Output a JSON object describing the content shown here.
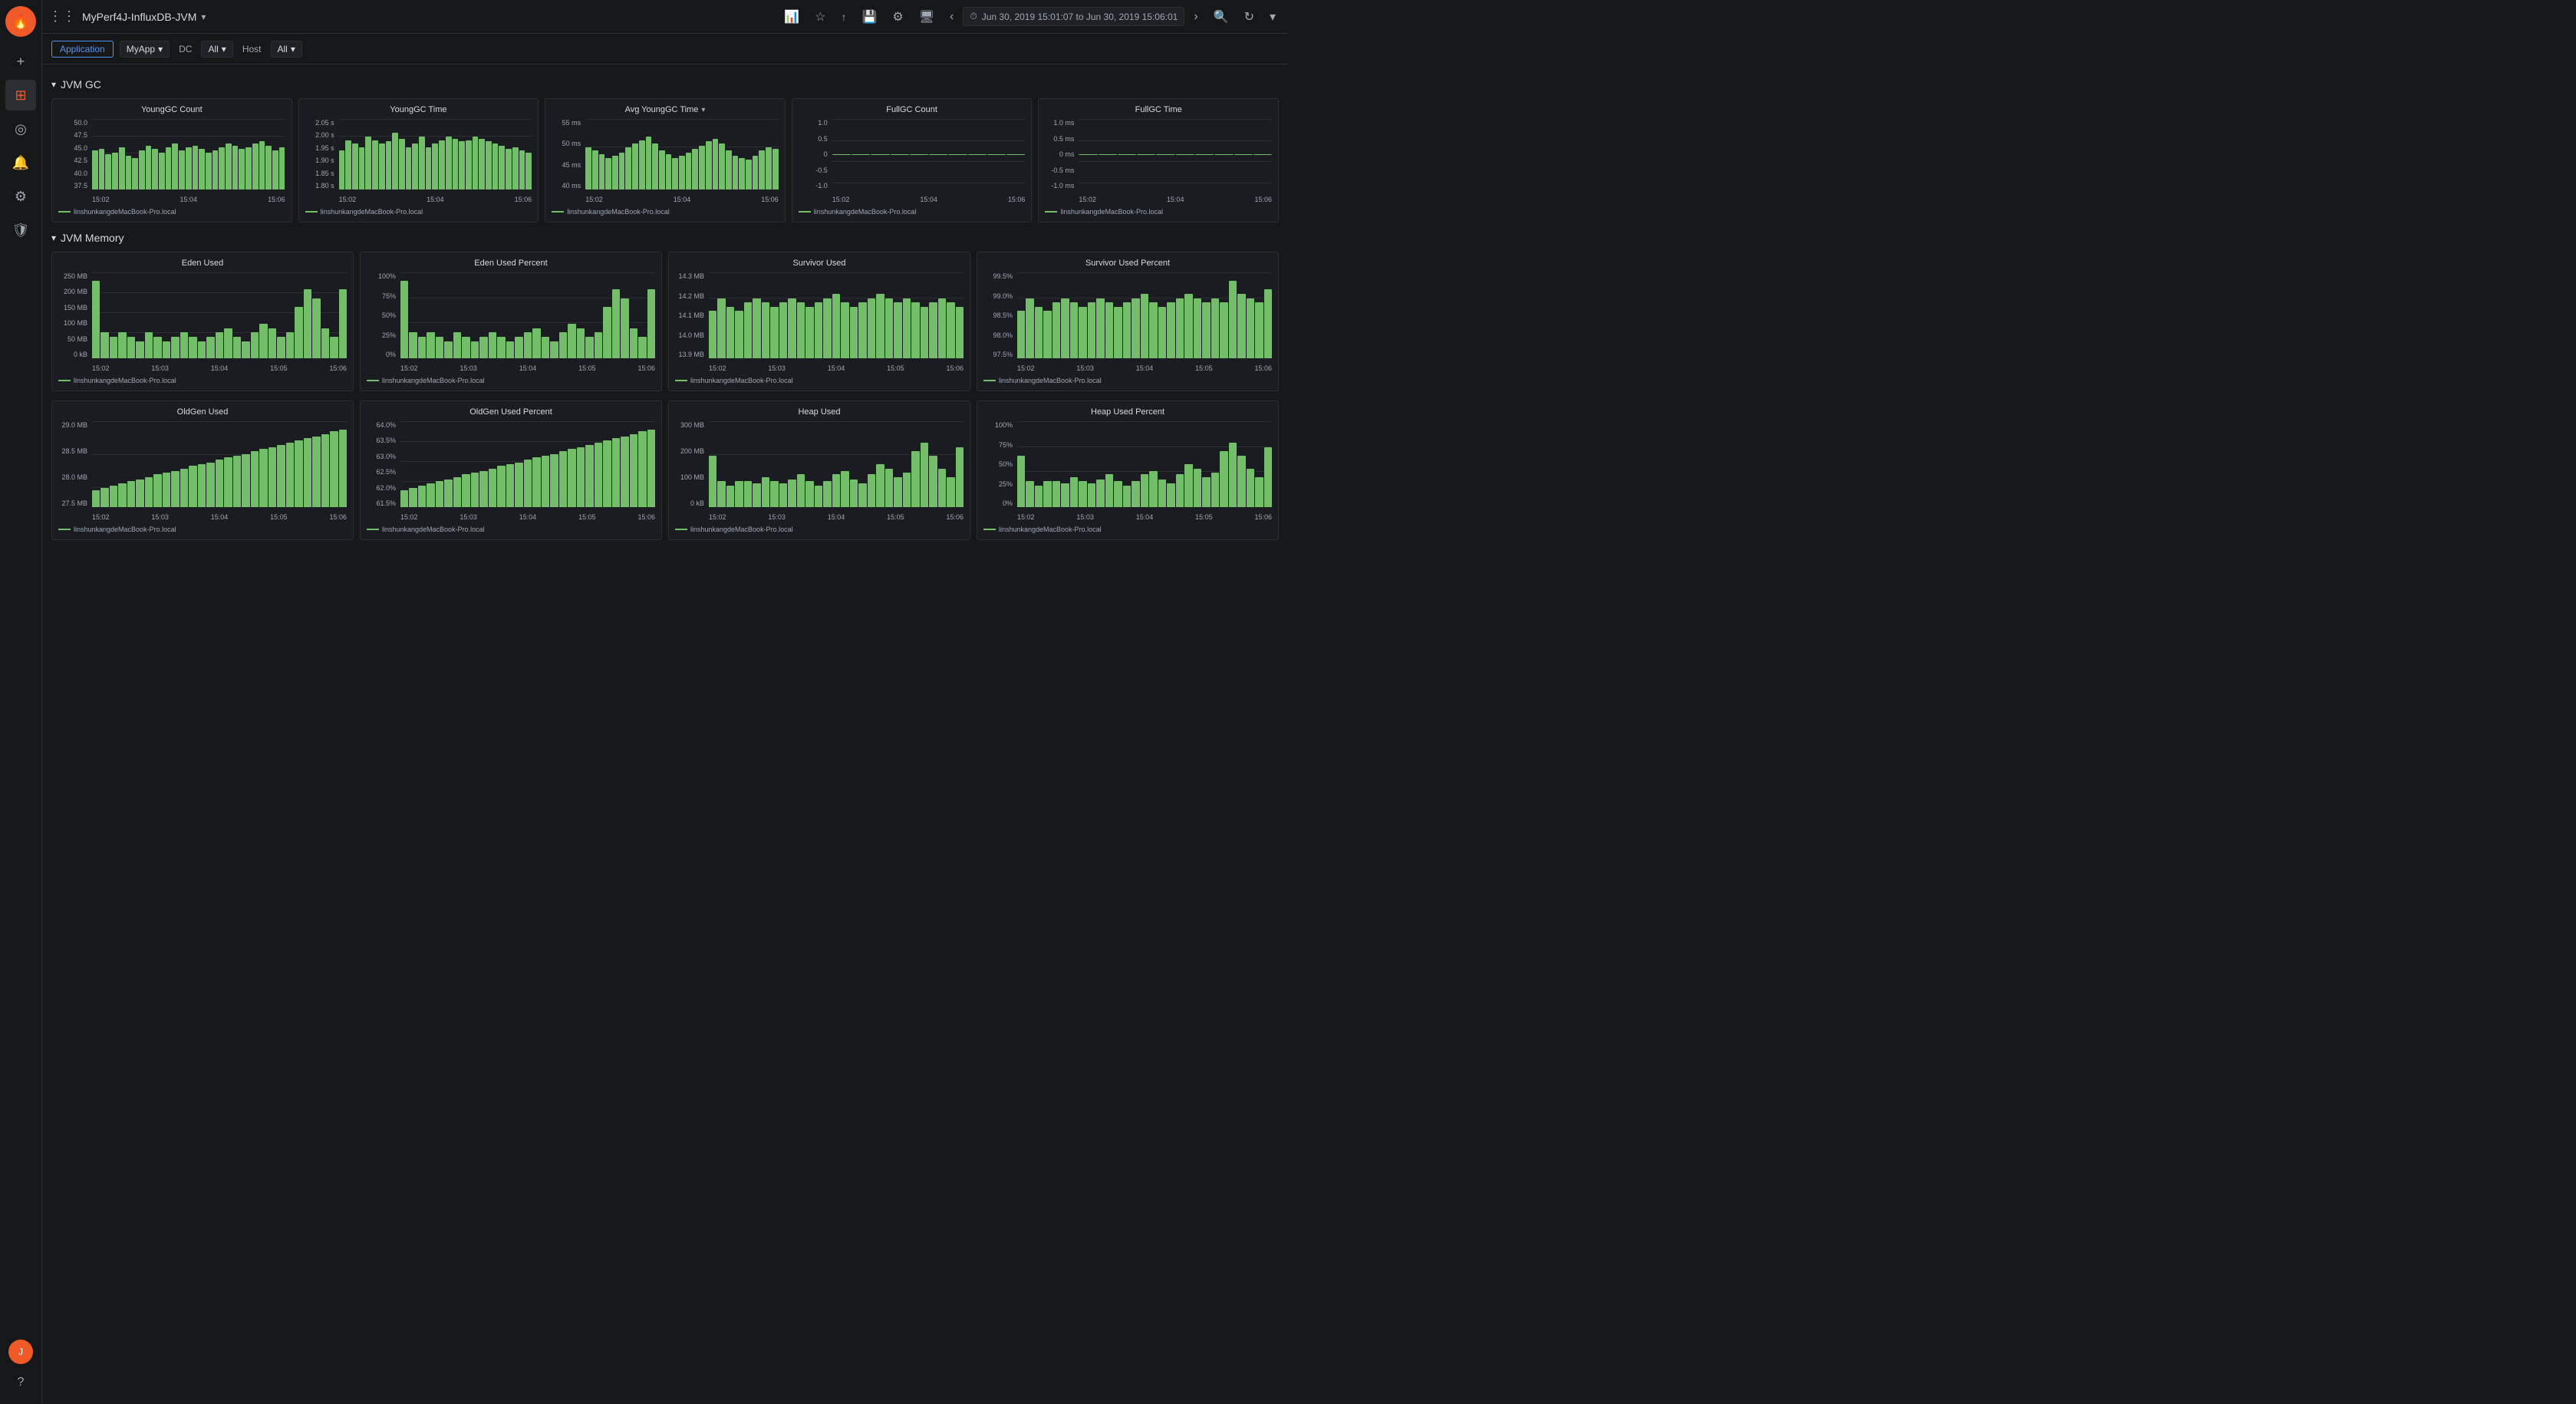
{
  "app": {
    "title": "MyPerf4J-InfluxDB-JVM",
    "logo_symbol": "🔥"
  },
  "topbar": {
    "time_range": "Jun 30, 2019 15:01:07 to Jun 30, 2019 15:06:01"
  },
  "sidebar": {
    "items": [
      {
        "label": "Add",
        "icon": "+"
      },
      {
        "label": "Dashboard",
        "icon": "⊞"
      },
      {
        "label": "Explore",
        "icon": "◎"
      },
      {
        "label": "Alerting",
        "icon": "🔔"
      },
      {
        "label": "Settings",
        "icon": "⚙"
      },
      {
        "label": "Shield",
        "icon": "🛡"
      }
    ]
  },
  "nav": {
    "application_label": "Application",
    "myapp_label": "MyApp",
    "dc_label": "DC",
    "dc_value": "All",
    "host_label": "Host",
    "host_value": "All"
  },
  "sections": [
    {
      "title": "JVM GC",
      "charts": [
        {
          "title": "YoungGC Count",
          "y_labels": [
            "50.0",
            "47.5",
            "45.0",
            "42.5",
            "40.0",
            "37.5"
          ],
          "x_labels": [
            "15:02",
            "15:04",
            "15:06"
          ],
          "bars": [
            55,
            58,
            50,
            52,
            60,
            48,
            45,
            55,
            62,
            58,
            52,
            60,
            65,
            55,
            60,
            62,
            58,
            52,
            55,
            60,
            65,
            62,
            58,
            60,
            65,
            68,
            62,
            55,
            60
          ],
          "legend": "linshunkangdeMacBook-Pro.local"
        },
        {
          "title": "YoungGC Time",
          "y_labels": [
            "2.05 s",
            "2.00 s",
            "1.95 s",
            "1.90 s",
            "1.85 s",
            "1.80 s"
          ],
          "x_labels": [
            "15:02",
            "15:04",
            "15:06"
          ],
          "bars": [
            55,
            70,
            65,
            60,
            75,
            70,
            65,
            68,
            80,
            72,
            60,
            65,
            75,
            60,
            65,
            70,
            75,
            72,
            68,
            70,
            75,
            72,
            68,
            65,
            62,
            58,
            60,
            55,
            52
          ],
          "legend": "linshunkangdeMacBook-Pro.local"
        },
        {
          "title": "Avg YoungGC Time",
          "has_dropdown": true,
          "y_labels": [
            "55 ms",
            "50 ms",
            "45 ms",
            "40 ms"
          ],
          "x_labels": [
            "15:02",
            "15:04",
            "15:06"
          ],
          "bars": [
            60,
            55,
            50,
            45,
            48,
            52,
            60,
            65,
            70,
            75,
            65,
            55,
            50,
            45,
            48,
            52,
            58,
            62,
            68,
            72,
            65,
            55,
            48,
            45,
            42,
            48,
            55,
            60,
            58
          ],
          "legend": "linshunkangdeMacBook-Pro.local"
        },
        {
          "title": "FullGC Count",
          "y_labels": [
            "1.0",
            "0.5",
            "0",
            "-0.5",
            "-1.0"
          ],
          "x_labels": [
            "15:02",
            "15:04",
            "15:06"
          ],
          "bars": [
            0,
            0,
            0,
            0,
            0,
            0,
            0,
            0,
            0,
            0,
            0,
            0,
            0,
            0,
            0,
            0,
            0,
            0,
            0,
            0,
            0,
            0,
            0,
            0,
            0,
            0,
            0,
            0,
            0
          ],
          "legend": "linshunkangdeMacBook-Pro.local"
        },
        {
          "title": "FullGC Time",
          "y_labels": [
            "1.0 ms",
            "0.5 ms",
            "0 ms",
            "-0.5 ms",
            "-1.0 ms"
          ],
          "x_labels": [
            "15:02",
            "15:04",
            "15:06"
          ],
          "bars": [
            0,
            0,
            0,
            0,
            0,
            0,
            0,
            0,
            0,
            0,
            0,
            0,
            0,
            0,
            0,
            0,
            0,
            0,
            0,
            0,
            0,
            0,
            0,
            0,
            0,
            0,
            0,
            0,
            0
          ],
          "legend": "linshunkangdeMacBook-Pro.local"
        }
      ]
    },
    {
      "title": "JVM Memory",
      "charts_row1": [
        {
          "title": "Eden Used",
          "y_labels": [
            "250 MB",
            "200 MB",
            "150 MB",
            "100 MB",
            "50 MB",
            "0 kB"
          ],
          "x_labels": [
            "15:02",
            "15:03",
            "15:04",
            "15:05",
            "15:06"
          ],
          "bars": [
            90,
            30,
            25,
            30,
            25,
            20,
            30,
            25,
            20,
            25,
            30,
            25,
            20,
            25,
            30,
            35,
            25,
            20,
            30,
            40,
            35,
            25,
            30,
            60,
            80,
            70,
            35,
            25,
            80
          ],
          "legend": "linshunkangdeMacBook-Pro.local"
        },
        {
          "title": "Eden Used Percent",
          "y_labels": [
            "100%",
            "75%",
            "50%",
            "25%",
            "0%"
          ],
          "x_labels": [
            "15:02",
            "15:03",
            "15:04",
            "15:05",
            "15:06"
          ],
          "bars": [
            90,
            30,
            25,
            30,
            25,
            20,
            30,
            25,
            20,
            25,
            30,
            25,
            20,
            25,
            30,
            35,
            25,
            20,
            30,
            40,
            35,
            25,
            30,
            60,
            80,
            70,
            35,
            25,
            80
          ],
          "legend": "linshunkangdeMacBook-Pro.local"
        },
        {
          "title": "Survivor Used",
          "y_labels": [
            "14.3 MB",
            "14.2 MB",
            "14.1 MB",
            "14.0 MB",
            "13.9 MB"
          ],
          "x_labels": [
            "15:02",
            "15:03",
            "15:04",
            "15:05",
            "15:06"
          ],
          "bars": [
            55,
            70,
            60,
            55,
            65,
            70,
            65,
            60,
            65,
            70,
            65,
            60,
            65,
            70,
            75,
            65,
            60,
            65,
            70,
            75,
            70,
            65,
            70,
            65,
            60,
            65,
            70,
            65,
            60
          ],
          "legend": "linshunkangdeMacBook-Pro.local"
        },
        {
          "title": "Survivor Used Percent",
          "y_labels": [
            "99.5%",
            "99.0%",
            "98.5%",
            "98.0%",
            "97.5%"
          ],
          "x_labels": [
            "15:02",
            "15:03",
            "15:04",
            "15:05",
            "15:06"
          ],
          "bars": [
            55,
            70,
            60,
            55,
            65,
            70,
            65,
            60,
            65,
            70,
            65,
            60,
            65,
            70,
            75,
            65,
            60,
            65,
            70,
            75,
            70,
            65,
            70,
            65,
            90,
            75,
            70,
            65,
            80
          ],
          "legend": "linshunkangdeMacBook-Pro.local"
        }
      ],
      "charts_row2": [
        {
          "title": "OldGen Used",
          "y_labels": [
            "29.0 MB",
            "28.5 MB",
            "28.0 MB",
            "27.5 MB"
          ],
          "x_labels": [
            "15:02",
            "15:03",
            "15:04",
            "15:05",
            "15:06"
          ],
          "bars": [
            20,
            22,
            25,
            28,
            30,
            32,
            35,
            38,
            40,
            42,
            45,
            48,
            50,
            52,
            55,
            58,
            60,
            62,
            65,
            68,
            70,
            72,
            75,
            78,
            80,
            82,
            85,
            88,
            90
          ],
          "legend": "linshunkangdeMacBook-Pro.local"
        },
        {
          "title": "OldGen Used Percent",
          "y_labels": [
            "64.0%",
            "63.5%",
            "63.0%",
            "62.5%",
            "62.0%",
            "61.5%"
          ],
          "x_labels": [
            "15:02",
            "15:03",
            "15:04",
            "15:05",
            "15:06"
          ],
          "bars": [
            20,
            22,
            25,
            28,
            30,
            32,
            35,
            38,
            40,
            42,
            45,
            48,
            50,
            52,
            55,
            58,
            60,
            62,
            65,
            68,
            70,
            72,
            75,
            78,
            80,
            82,
            85,
            88,
            90
          ],
          "legend": "linshunkangdeMacBook-Pro.local"
        },
        {
          "title": "Heap Used",
          "y_labels": [
            "300 MB",
            "200 MB",
            "100 MB",
            "0 kB"
          ],
          "x_labels": [
            "15:02",
            "15:03",
            "15:04",
            "15:05",
            "15:06"
          ],
          "bars": [
            60,
            30,
            25,
            30,
            30,
            28,
            35,
            30,
            28,
            32,
            38,
            30,
            25,
            30,
            38,
            42,
            32,
            28,
            38,
            50,
            45,
            35,
            40,
            65,
            75,
            60,
            45,
            35,
            70
          ],
          "legend": "linshunkangdeMacBook-Pro.local"
        },
        {
          "title": "Heap Used Percent",
          "y_labels": [
            "100%",
            "75%",
            "50%",
            "25%",
            "0%"
          ],
          "x_labels": [
            "15:02",
            "15:03",
            "15:04",
            "15:05",
            "15:06"
          ],
          "bars": [
            60,
            30,
            25,
            30,
            30,
            28,
            35,
            30,
            28,
            32,
            38,
            30,
            25,
            30,
            38,
            42,
            32,
            28,
            38,
            50,
            45,
            35,
            40,
            65,
            75,
            60,
            45,
            35,
            70
          ],
          "legend": "linshunkangdeMacBook-Pro.local"
        }
      ]
    }
  ],
  "icons": {
    "dashboard": "⊞",
    "add": "+",
    "explore": "◎",
    "alert": "🔔",
    "settings": "⚙",
    "shield": "🛡",
    "star": "★",
    "share": "↑",
    "save": "💾",
    "gear": "⚙",
    "monitor": "🖥",
    "chevron_left": "‹",
    "clock": "⏱",
    "chevron_right": "›",
    "search": "🔍",
    "refresh": "↻",
    "chevron_down": "▾",
    "apps": "⋮⋮"
  }
}
